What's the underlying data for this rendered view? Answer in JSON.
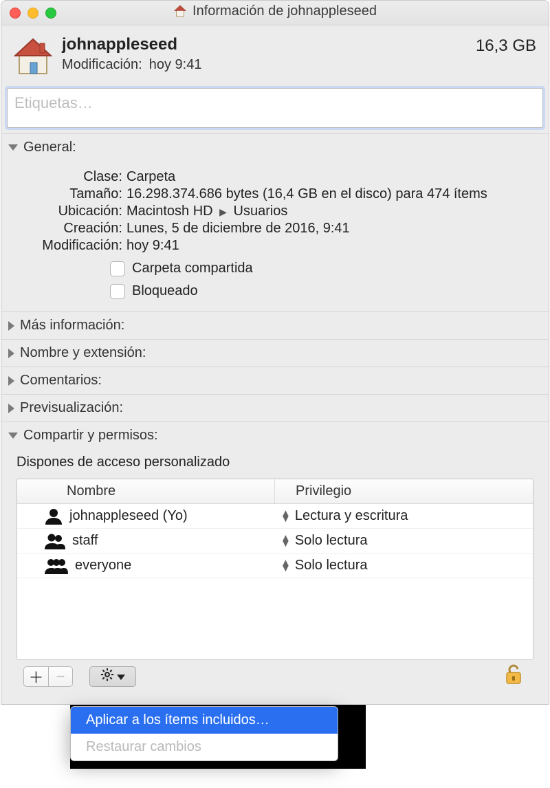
{
  "titlebar": {
    "title": "Información de johnappleseed"
  },
  "header": {
    "name": "johnappleseed",
    "mod_label": "Modificación:",
    "mod_value": "hoy 9:41",
    "size": "16,3 GB"
  },
  "tags": {
    "placeholder": "Etiquetas…"
  },
  "sections": {
    "general": "General:",
    "more_info": "Más información:",
    "name_ext": "Nombre y extensión:",
    "comments": "Comentarios:",
    "preview": "Previsualización:",
    "sharing": "Compartir y permisos:"
  },
  "general": {
    "kind_label": "Clase:",
    "kind_value": "Carpeta",
    "size_label": "Tamaño:",
    "size_value": "16.298.374.686 bytes (16,4 GB en el disco) para 474 ítems",
    "where_label": "Ubicación:",
    "where_value_1": "Macintosh HD",
    "where_value_2": "Usuarios",
    "created_label": "Creación:",
    "created_value": "Lunes, 5 de diciembre de 2016, 9:41",
    "modified_label": "Modificación:",
    "modified_value": "hoy 9:41",
    "shared_folder": "Carpeta compartida",
    "locked": "Bloqueado"
  },
  "sharing": {
    "access_text": "Dispones de acceso personalizado",
    "col_name": "Nombre",
    "col_priv": "Privilegio",
    "rows": [
      {
        "name": "johnappleseed (Yo)",
        "priv": "Lectura y escritura"
      },
      {
        "name": "staff",
        "priv": "Solo lectura"
      },
      {
        "name": "everyone",
        "priv": "Solo lectura"
      }
    ]
  },
  "popup": {
    "apply": "Aplicar a los ítems incluidos…",
    "revert": "Restaurar cambios"
  }
}
